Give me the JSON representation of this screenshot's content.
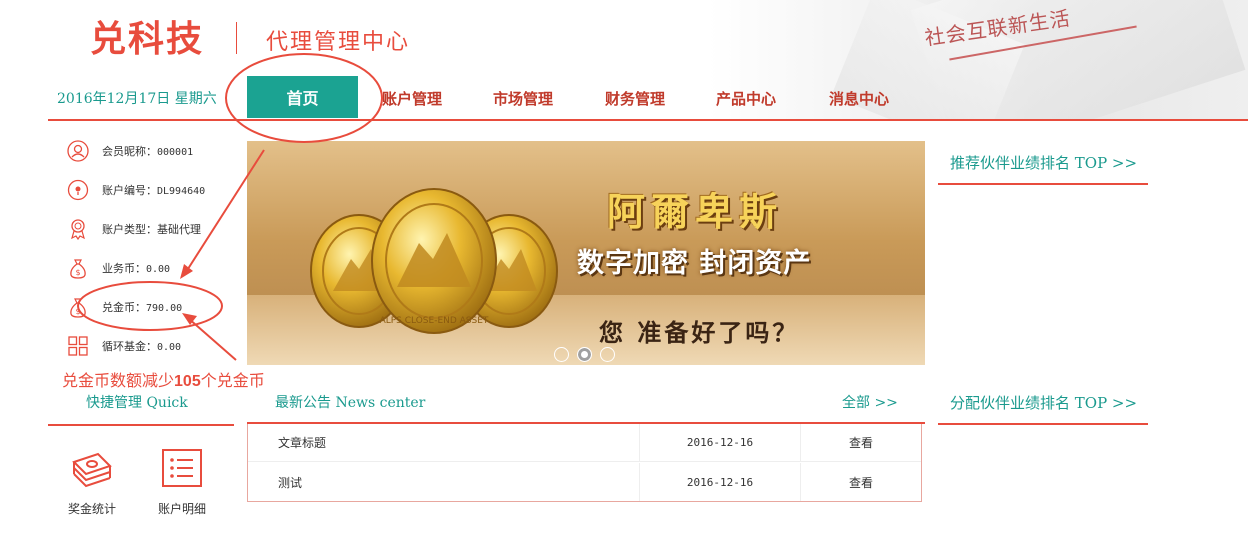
{
  "header": {
    "logo": "兑科技",
    "subtitle": "代理管理中心",
    "slogan": "社会互联新生活"
  },
  "date": "2016年12月17日 星期六",
  "nav": {
    "home": "首页",
    "items": [
      "账户管理",
      "市场管理",
      "财务管理",
      "产品中心",
      "消息中心"
    ]
  },
  "member": {
    "nickname_label": "会员昵称：",
    "nickname": "000001",
    "account_label": "账户编号：",
    "account": "DL994640",
    "type_label": "账户类型：",
    "type": "基础代理",
    "business_label": "业务币：",
    "business": "0.00",
    "exchange_label": "兑金币：",
    "exchange": "790.00",
    "fund_label": "循环基金：",
    "fund": "0.00"
  },
  "annotation": {
    "pre": "兑金币数额减少",
    "num": "105",
    "post": "个兑金币"
  },
  "quick": {
    "title": "快捷管理 Quick",
    "items": [
      "奖金统计",
      "账户明细"
    ]
  },
  "banner": {
    "title": "阿爾卑斯",
    "line2": "数字加密 封闭资产",
    "line3": "您 准备好了吗？",
    "coin_text": "ALPS CLOSE-END ASSET"
  },
  "news": {
    "title": "最新公告 News center",
    "all": "全部 >>",
    "rows": [
      {
        "title": "文章标题",
        "date": "2016-12-16",
        "action": "查看"
      },
      {
        "title": "测试",
        "date": "2016-12-16",
        "action": "查看"
      }
    ]
  },
  "rankings": {
    "recommend": "推荐伙伴业绩排名 TOP  >>",
    "distribute": "分配伙伴业绩排名 TOP  >>"
  },
  "colors": {
    "brand_red": "#e84c3d",
    "teal": "#1ba392",
    "teal_text": "#1a9a8e"
  }
}
